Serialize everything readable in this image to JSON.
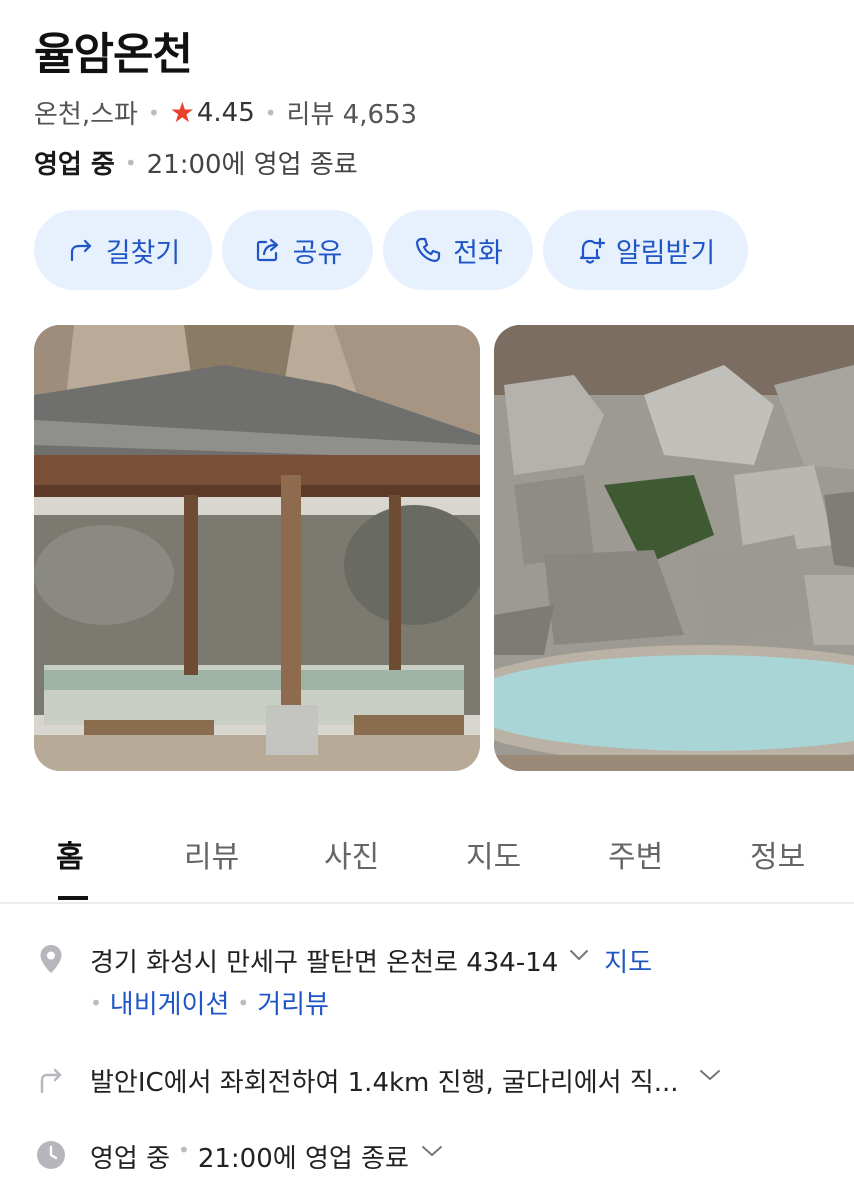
{
  "place": {
    "name": "율암온천",
    "category": "온천,스파",
    "rating": "4.45",
    "review_label": "리뷰 4,653",
    "status": "영업 중",
    "closing": "21:00에 영업 종료"
  },
  "actions": [
    {
      "label": "길찾기",
      "icon": "directions-icon"
    },
    {
      "label": "공유",
      "icon": "share-icon"
    },
    {
      "label": "전화",
      "icon": "phone-icon"
    },
    {
      "label": "알림받기",
      "icon": "bell-plus-icon"
    }
  ],
  "tabs": [
    {
      "label": "홈",
      "active": true
    },
    {
      "label": "리뷰"
    },
    {
      "label": "사진"
    },
    {
      "label": "지도"
    },
    {
      "label": "주변"
    },
    {
      "label": "정보"
    }
  ],
  "info": {
    "address": "경기 화성시 만세구 팔탄면 온천로 434-14",
    "map_link": "지도",
    "navigation_link": "내비게이션",
    "streetview_link": "거리뷰",
    "directions": "발안IC에서 좌회전하여 1.4km 진행, 굴다리에서 직...",
    "hours_status": "영업 중",
    "hours_closing": "21:00에 영업 종료"
  },
  "colors": {
    "accent": "#1f56c7",
    "chip_bg": "#e7f0fd",
    "star": "#e8412c"
  }
}
